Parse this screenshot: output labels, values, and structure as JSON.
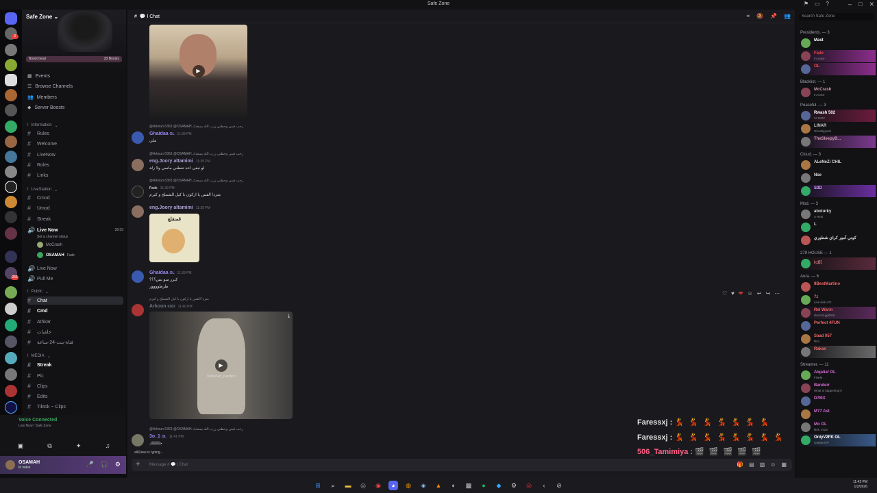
{
  "window": {
    "title": "Safe Zone"
  },
  "server": {
    "name": "Safe Zone",
    "boost_goal": "Boost Goal",
    "boosts": "33 Boosts",
    "nav": [
      "Events",
      "Browse Channels",
      "Members",
      "Server Boosts"
    ]
  },
  "categories": {
    "information": "Information",
    "livestation": "LiveStation",
    "public": "Public",
    "media": "MEDIA"
  },
  "channels": {
    "info": [
      "Rules",
      "Welcome",
      "LiveNow",
      "Roles",
      "Links"
    ],
    "live": [
      "Cmod",
      "Umod",
      "Streak"
    ],
    "live_now": "Live Now",
    "live_now_time": "39:33",
    "channel_status": "Set a channel status",
    "voice_users": [
      "McCrash",
      "OSAMAH"
    ],
    "voice_user_tag": "Fade",
    "live_more": [
      "Live Now",
      "Pull Me"
    ],
    "public": [
      "Chat",
      "Cmd",
      "Athkar",
      "خلفيات",
      "فتاة-بنت-24-ساعة"
    ],
    "media": [
      "Streak",
      "Pic",
      "Clips",
      "Edits",
      "Tiktok ~ Clips"
    ]
  },
  "voice": {
    "title": "Voice Connected",
    "sub": "Live Now / Safe Zone"
  },
  "user": {
    "name": "OSAMAH",
    "status": "In voice"
  },
  "chat": {
    "channel": "Chat",
    "messages": [
      {
        "reply": "@Arkoun 6363 @OSAMAH رحب فيني وحطني زرب الله يسعدك",
        "author": "Ghaidaa",
        "tag": "OL",
        "time": "11:39 PM",
        "text": "ملي",
        "color": "#9b84ee"
      },
      {
        "reply": "@Arkoun 6363 @OSAMAH رحب فيني وحطني زرب الله يسعدك",
        "author": "eng.Joory altamimi",
        "tag": "",
        "time": "11:39 PM",
        "text": "لو تبغى احد تعطني ماسي ولا زلة",
        "color": "#ad9fd6"
      },
      {
        "reply": "@Arkoun 6363 @OSAMAH رحب فيني وحطني زرب الله يسعدك",
        "author": "",
        "tag": "Fade",
        "time": "11:39 PM",
        "text": "مترد! الفس يا اركون با كيل الشملح و كيرم",
        "color": "#e44"
      },
      {
        "reply": "",
        "author": "eng.Joory altamimi",
        "tag": "",
        "time": "11:39 PM",
        "text": "",
        "color": "#ad9fd6"
      },
      {
        "reply": "",
        "author": "Ghaidaa",
        "tag": "OL",
        "time": "11:39 PM",
        "text": "كيرر منو بس؟؟؟",
        "text2": "طرطوووور",
        "color": "#9b84ee"
      },
      {
        "reply": "مترد! الفس يا اركون با كيل الشملح و كيرم",
        "author": "Arkoun",
        "tag": "6363",
        "time": "11:40 PM",
        "text": "",
        "color": "#6f7380"
      },
      {
        "reply": "@Arkoun 6363 @OSAMAH رحب فيني وحطني زرب الله يسعدك",
        "author": "3o_1",
        "tag": "OL",
        "time": "11:41 PM",
        "text": "حلللللك",
        "color": "#9b84ee"
      }
    ],
    "sticker_label": "قمنقلع",
    "video_caption": "TwitterVid_reaction",
    "typing": "al82eee is typing...",
    "input_placeholder": "Message # 💬 | Chat"
  },
  "overlay": [
    {
      "name": "Faressxj :",
      "emo": "💃💃💃💃💃💃💃",
      "color": "#e6e6e6"
    },
    {
      "name": "Faressxj :",
      "emo": "💃💃💃💃💃💃💃💃",
      "color": "#e6e6e6"
    },
    {
      "name": "506_Tamimiya :",
      "emo": "🎬🎬🎬🎬🎬",
      "color": "#ff5f86"
    }
  ],
  "members": {
    "search_placeholder": "Search Safe Zone",
    "groups": [
      {
        "label": "Presidents. — 3",
        "items": [
          {
            "name": "Mast",
            "status": "",
            "color": "#fff",
            "bg": ""
          },
          {
            "name": "Fade",
            "status": "In voice",
            "color": "#e44",
            "bg": "#8c2d8c"
          },
          {
            "name": "OL",
            "status": "",
            "color": "#e44",
            "bg": "#8c2d8c"
          }
        ]
      },
      {
        "label": "Blacklist. — 1",
        "items": [
          {
            "name": "McCrash",
            "status": "In voice",
            "color": "#c9a",
            "bg": ""
          }
        ]
      },
      {
        "label": "Peaceful. — 3",
        "items": [
          {
            "name": "Rwash 502",
            "status": "24 NOV",
            "color": "#fff",
            "bg": "#6b1c3e"
          },
          {
            "name": "LINAR",
            "status": "Ghostlyyetal",
            "color": "#ccc",
            "bg": ""
          },
          {
            "name": "TheSleepyB...",
            "status": "",
            "color": "#c9a",
            "bg": "#7b3a8e"
          }
        ]
      },
      {
        "label": "Cloud. — 3",
        "items": [
          {
            "name": "ALeNeZi CHIL",
            "status": "",
            "color": "#ddd",
            "bg": ""
          },
          {
            "name": "Nse",
            "status": "",
            "color": "#ddd",
            "bg": ""
          },
          {
            "name": "S3D",
            "status": "",
            "color": "#d6a0ff",
            "bg": "#6b2ea0"
          }
        ]
      },
      {
        "label": "Mod. — 3",
        "items": [
          {
            "name": "aboturky",
            "status": "A Rest",
            "color": "#ddd",
            "bg": ""
          },
          {
            "name": "L",
            "status": "",
            "color": "#ddd",
            "bg": ""
          },
          {
            "name": "كوني أمور كراي شطوري",
            "status": "",
            "color": "#ddd",
            "bg": ""
          }
        ]
      },
      {
        "label": "279 HOUSE — 1",
        "items": [
          {
            "name": "ﾚｪﾛﾐ",
            "status": "",
            "color": "#e88",
            "bg": "#5a2a3a"
          }
        ]
      },
      {
        "label": "Aura. — 6",
        "items": [
          {
            "name": "IIBestMartino",
            "status": "",
            "color": "#e66",
            "bg": ""
          },
          {
            "name": "7z",
            "status": "Live kick s7z",
            "color": "#e66",
            "bg": ""
          },
          {
            "name": "Rel Warm",
            "status": "discord.gg/MJU",
            "color": "#e66",
            "bg": "#5a2a5a"
          },
          {
            "name": "Perfect 4FUN",
            "status": "",
            "color": "#e66",
            "bg": ""
          },
          {
            "name": "Saad 057",
            "status": "Rim",
            "color": "#e66",
            "bg": ""
          },
          {
            "name": "Rakan",
            "status": "",
            "color": "#e66",
            "bg": "#6a6a6a"
          }
        ]
      },
      {
        "label": "Streamer. — 11",
        "items": [
          {
            "name": "Alqaliaf OL",
            "status": "FiveM",
            "color": "#d46ad0",
            "bg": ""
          },
          {
            "name": "Banderr",
            "status": "What is happening?!",
            "color": "#d46ad0",
            "bg": ""
          },
          {
            "name": "D7MX",
            "status": "",
            "color": "#d46ad0",
            "bg": ""
          },
          {
            "name": "M77 Ast",
            "status": "",
            "color": "#d46ad0",
            "bg": ""
          },
          {
            "name": "Mo OL",
            "status": "kick: vs23",
            "color": "#d46ad0",
            "bg": ""
          },
          {
            "name": "OnlyV2FK OL",
            "status": "Outlaw RP",
            "color": "#fff",
            "bg": "#3a5a8a"
          }
        ]
      }
    ]
  },
  "clock": {
    "time": "11:42 PM",
    "date": "1/2/2026"
  }
}
